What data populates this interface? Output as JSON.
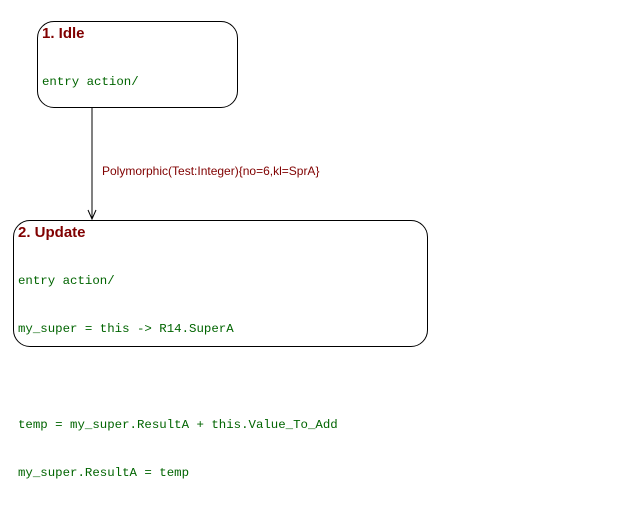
{
  "colors": {
    "title": "#800000",
    "body": "#006400",
    "event": "#800000",
    "line": "#000000"
  },
  "states": {
    "idle": {
      "title": "1. Idle",
      "lines": [
        "entry action/"
      ]
    },
    "update": {
      "title": "2. Update",
      "lines": [
        "entry action/",
        "my_super = this -> R14.SuperA",
        "",
        "temp = my_super.ResultA + this.Value_To_Add",
        "my_super.ResultA = temp"
      ]
    }
  },
  "transition": {
    "label": "Polymorphic(Test:Integer){no=6,kl=SprA}"
  }
}
